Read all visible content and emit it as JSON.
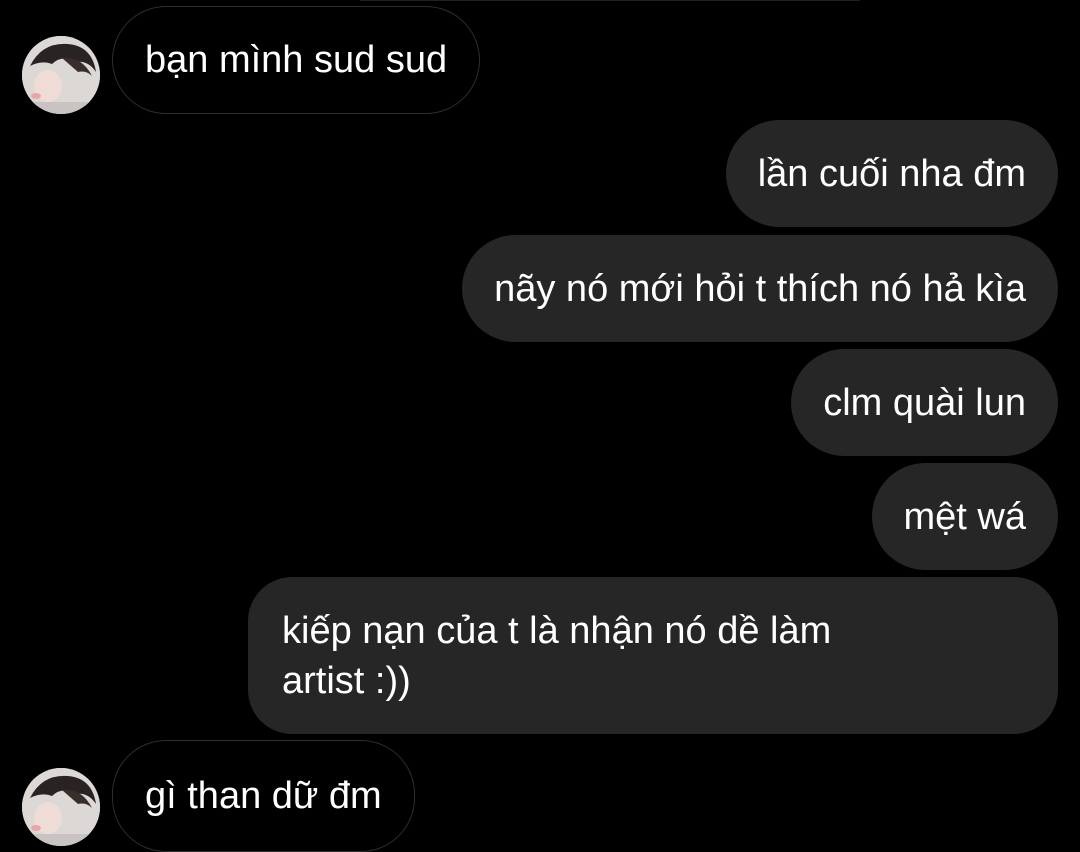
{
  "conversation": {
    "messages": [
      {
        "sender": "other",
        "text": "bạn mình sud sud"
      },
      {
        "sender": "me",
        "text": "lần cuối nha đm"
      },
      {
        "sender": "me",
        "text": "nãy nó mới hỏi t thích nó hả kìa"
      },
      {
        "sender": "me",
        "text": "clm quài lun"
      },
      {
        "sender": "me",
        "text": "mệt wá"
      },
      {
        "sender": "me",
        "text": "kiếp nạn của t là nhận nó dề làm artist :))"
      },
      {
        "sender": "other",
        "text": "gì than dữ đm"
      }
    ]
  },
  "colors": {
    "background": "#000000",
    "outgoing_bubble": "#262626",
    "incoming_border": "#2e2e2e",
    "text": "#ffffff"
  },
  "icons": {
    "avatar": "contact-avatar-photo"
  }
}
